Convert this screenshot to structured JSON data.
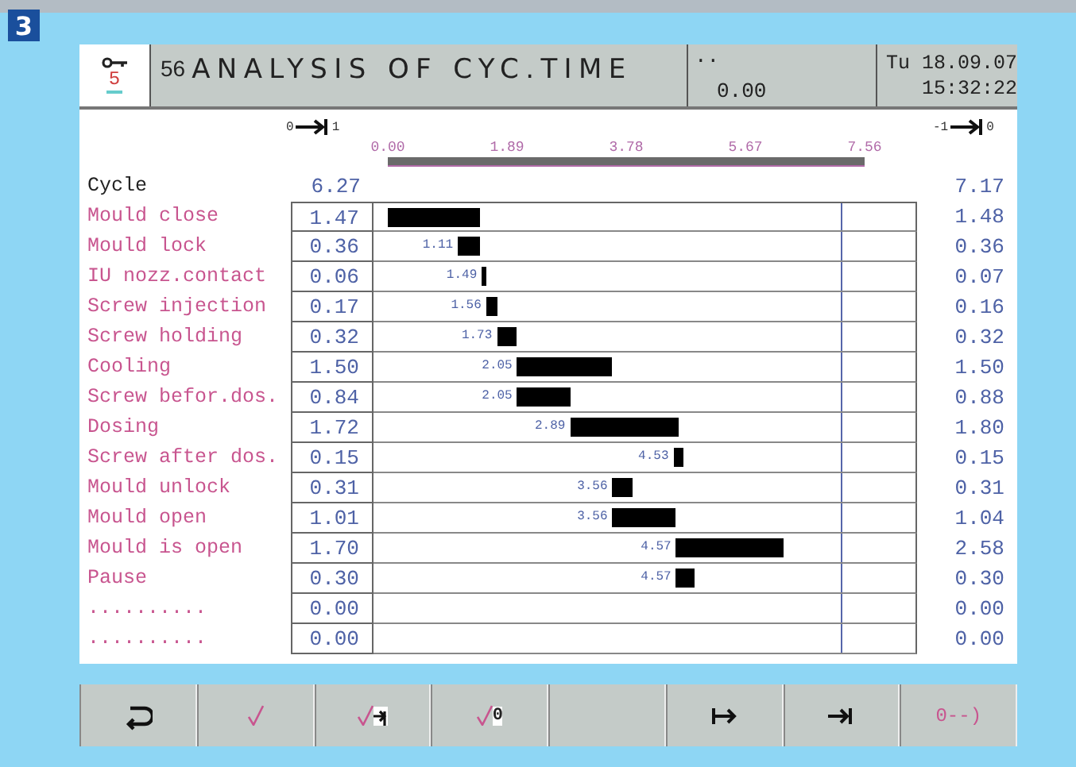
{
  "figure_badge": "3",
  "header": {
    "access_level": "5",
    "screen_number": "56",
    "title": "ANALYSIS OF CYC.TIME",
    "status_dots": "..",
    "status_value": "0.00",
    "date": "Tu 18.09.07",
    "time": "15:32:22"
  },
  "axis": {
    "left_from": "0",
    "left_to": "1",
    "right_from": "-1",
    "right_to": "0",
    "ticks": [
      "0.00",
      "1.89",
      "3.78",
      "5.67",
      "7.56"
    ]
  },
  "cycle": {
    "label": "Cycle",
    "value": "6.27",
    "reference": "7.17"
  },
  "rows": [
    {
      "label": "Mould close",
      "value": "1.47",
      "reference": "1.48"
    },
    {
      "label": "Mould lock",
      "value": "0.36",
      "start": "1.11",
      "reference": "0.36"
    },
    {
      "label": "IU nozz.contact",
      "value": "0.06",
      "start": "1.49",
      "reference": "0.07"
    },
    {
      "label": "Screw injection",
      "value": "0.17",
      "start": "1.56",
      "reference": "0.16"
    },
    {
      "label": "Screw holding",
      "value": "0.32",
      "start": "1.73",
      "reference": "0.32"
    },
    {
      "label": "Cooling",
      "value": "1.50",
      "start": "2.05",
      "reference": "1.50"
    },
    {
      "label": "Screw befor.dos.",
      "value": "0.84",
      "start": "2.05",
      "reference": "0.88"
    },
    {
      "label": "Dosing",
      "value": "1.72",
      "start": "2.89",
      "reference": "1.80"
    },
    {
      "label": "Screw after dos.",
      "value": "0.15",
      "start": "4.53",
      "reference": "0.15"
    },
    {
      "label": "Mould unlock",
      "value": "0.31",
      "start": "3.56",
      "reference": "0.31"
    },
    {
      "label": "Mould open",
      "value": "1.01",
      "start": "3.56",
      "reference": "1.04"
    },
    {
      "label": "Mould is open",
      "value": "1.70",
      "start": "4.57",
      "reference": "2.58"
    },
    {
      "label": "Pause",
      "value": "0.30",
      "start": "4.57",
      "reference": "0.30"
    },
    {
      "label": "..........",
      "value": "0.00",
      "reference": "0.00"
    },
    {
      "label": "..........",
      "value": "0.00",
      "reference": "0.00"
    }
  ],
  "softkeys": [
    {
      "kind": "return"
    },
    {
      "kind": "check"
    },
    {
      "kind": "check-arrow"
    },
    {
      "kind": "check-text",
      "label": "0"
    },
    {
      "kind": "blank"
    },
    {
      "kind": "arrow-from-bar"
    },
    {
      "kind": "arrow-to-bar"
    },
    {
      "kind": "text",
      "label": "0--)"
    }
  ]
}
